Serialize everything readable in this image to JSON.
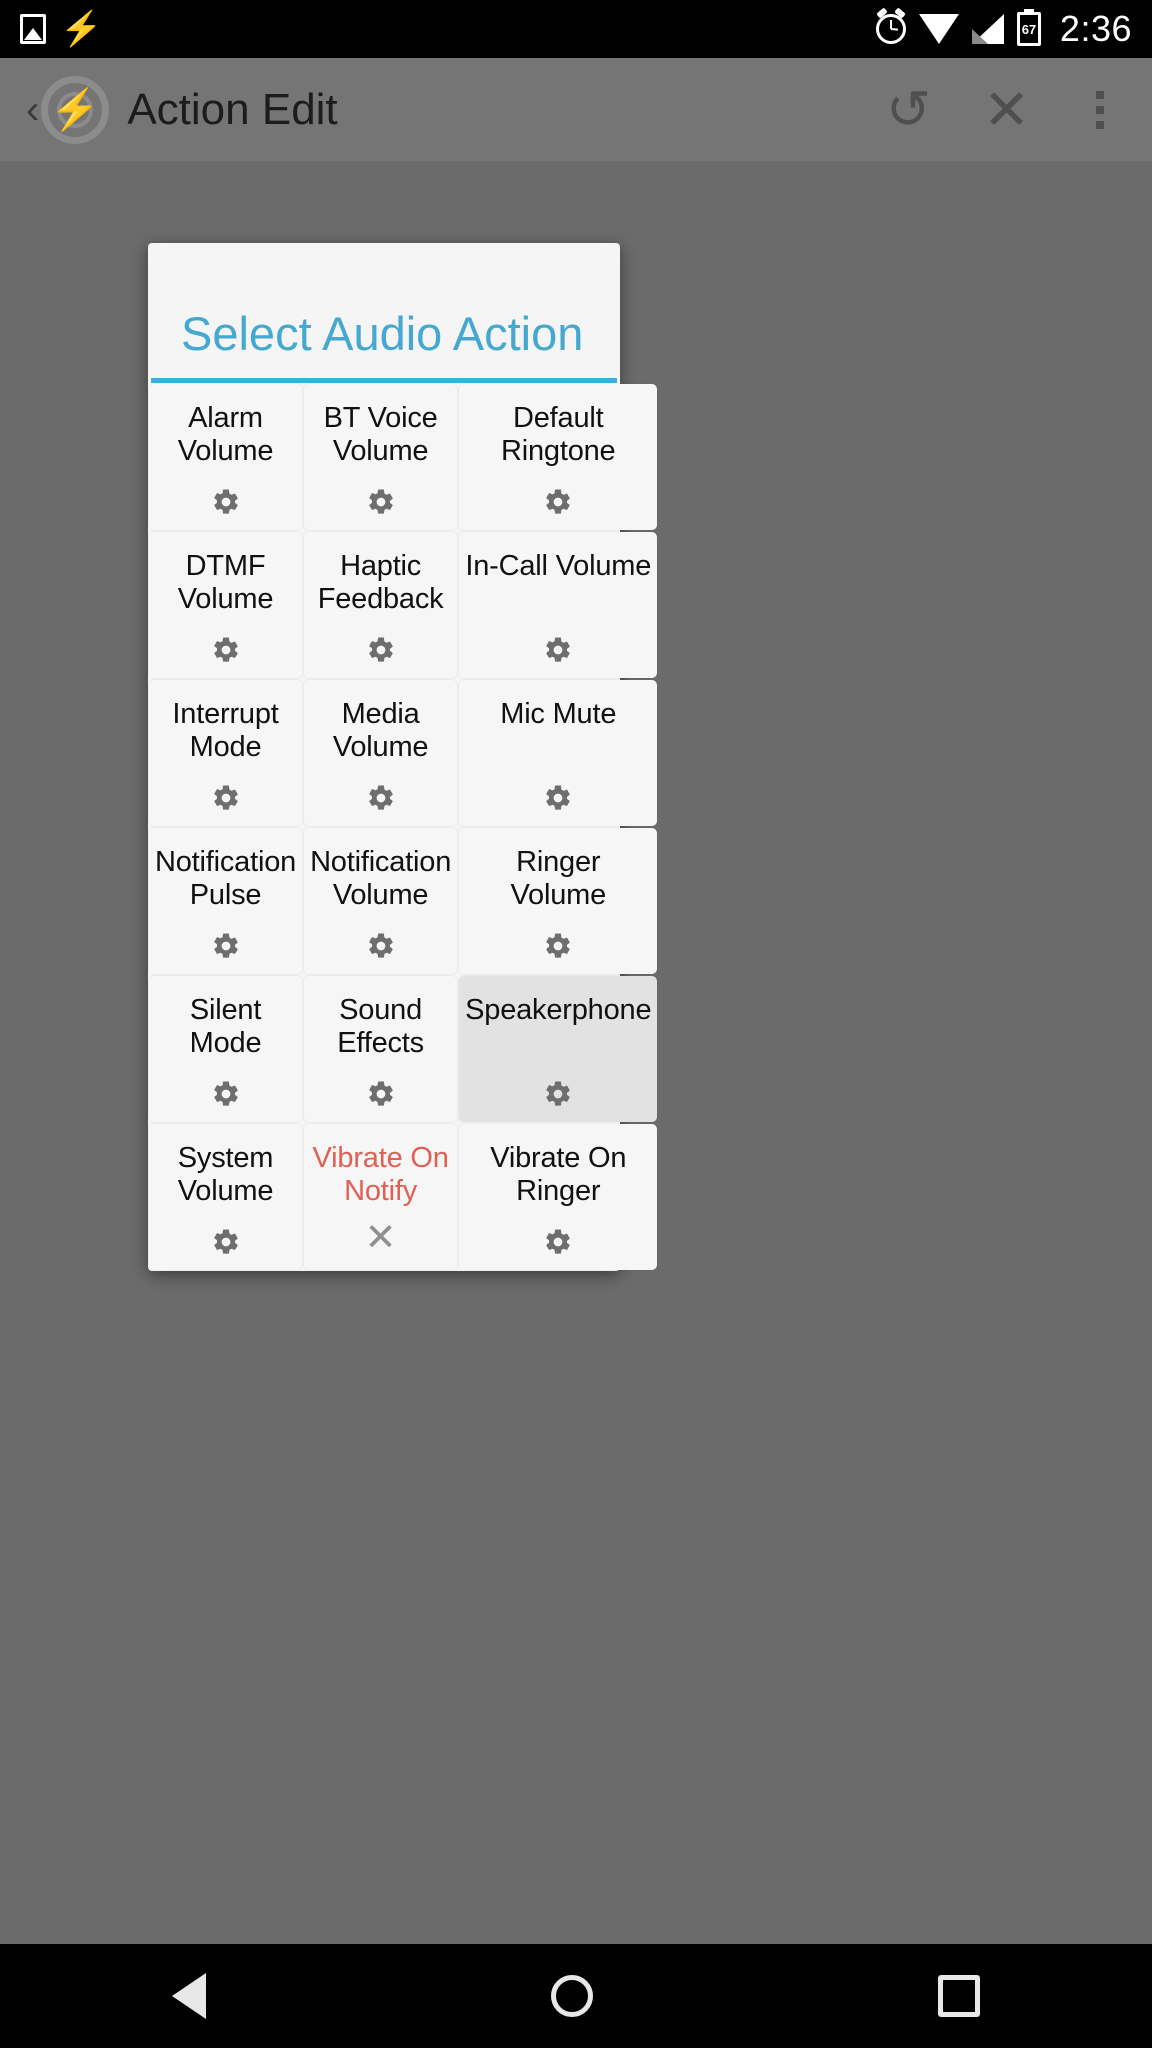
{
  "status_bar": {
    "time": "2:36",
    "battery_level": "67",
    "icons": [
      "screenshot-icon",
      "lightning-bolt-icon",
      "alarm-icon",
      "wifi-icon",
      "cell-signal-icon",
      "battery-icon"
    ]
  },
  "action_bar": {
    "back_label": "‹",
    "app_icon": "tasker-gear-lightning-icon",
    "title": "Action Edit",
    "undo_label": "↺",
    "close_label": "✕",
    "overflow_label": "overflow-menu"
  },
  "dialog": {
    "title": "Select Audio Action",
    "accent_color": "#36b0dd",
    "title_color": "#45a8d0",
    "warn_color": "#e06055",
    "selected_bg": "#e2e2e2",
    "items": [
      {
        "label": "Alarm Volume",
        "icon": "gear-icon",
        "state": "normal"
      },
      {
        "label": "BT Voice Volume",
        "icon": "gear-icon",
        "state": "normal"
      },
      {
        "label": "Default Ringtone",
        "icon": "gear-icon",
        "state": "normal"
      },
      {
        "label": "DTMF Volume",
        "icon": "gear-icon",
        "state": "normal"
      },
      {
        "label": "Haptic Feedback",
        "icon": "gear-icon",
        "state": "normal"
      },
      {
        "label": "In-Call Volume",
        "icon": "gear-icon",
        "state": "normal"
      },
      {
        "label": "Interrupt Mode",
        "icon": "gear-icon",
        "state": "normal"
      },
      {
        "label": "Media Volume",
        "icon": "gear-icon",
        "state": "normal"
      },
      {
        "label": "Mic Mute",
        "icon": "gear-icon",
        "state": "normal"
      },
      {
        "label": "Notification Pulse",
        "icon": "gear-icon",
        "state": "normal"
      },
      {
        "label": "Notification Volume",
        "icon": "gear-icon",
        "state": "normal"
      },
      {
        "label": "Ringer Volume",
        "icon": "gear-icon",
        "state": "normal"
      },
      {
        "label": "Silent Mode",
        "icon": "gear-icon",
        "state": "normal"
      },
      {
        "label": "Sound Effects",
        "icon": "gear-icon",
        "state": "normal"
      },
      {
        "label": "Speakerphone",
        "icon": "gear-icon",
        "state": "selected"
      },
      {
        "label": "System Volume",
        "icon": "gear-icon",
        "state": "normal"
      },
      {
        "label": "Vibrate On Notify",
        "icon": "close-icon",
        "state": "warn"
      },
      {
        "label": "Vibrate On Ringer",
        "icon": "gear-icon",
        "state": "normal"
      }
    ]
  },
  "nav_bar": {
    "back": "nav-back-icon",
    "home": "nav-home-icon",
    "recents": "nav-recents-icon"
  }
}
